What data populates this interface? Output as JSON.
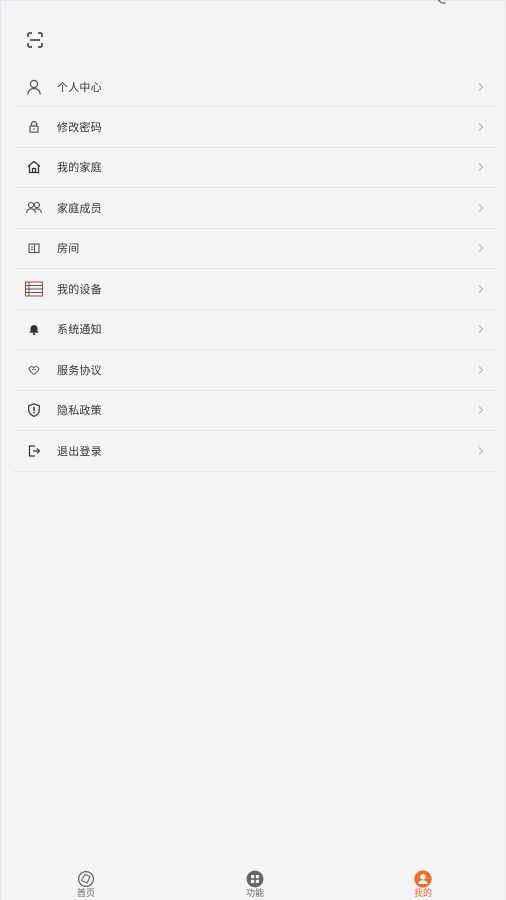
{
  "menu": {
    "items": [
      {
        "label": "个人中心",
        "icon": "user-icon"
      },
      {
        "label": "修改密码",
        "icon": "lock-icon"
      },
      {
        "label": "我的家庭",
        "icon": "home-icon"
      },
      {
        "label": "家庭成员",
        "icon": "members-icon"
      },
      {
        "label": "房间",
        "icon": "room-icon"
      },
      {
        "label": "我的设备",
        "icon": "device-list-icon"
      },
      {
        "label": "系统通知",
        "icon": "bell-icon"
      },
      {
        "label": "服务协议",
        "icon": "agreement-icon"
      },
      {
        "label": "隐私政策",
        "icon": "shield-icon"
      },
      {
        "label": "退出登录",
        "icon": "logout-icon"
      }
    ]
  },
  "tabbar": {
    "home_label": "首页",
    "function_label": "功能",
    "me_label": "我的",
    "active_tab": "我的"
  },
  "colors": {
    "background": "#f3f4f6",
    "accent": "#f26b30",
    "text": "#333333",
    "icon": "#555555"
  }
}
